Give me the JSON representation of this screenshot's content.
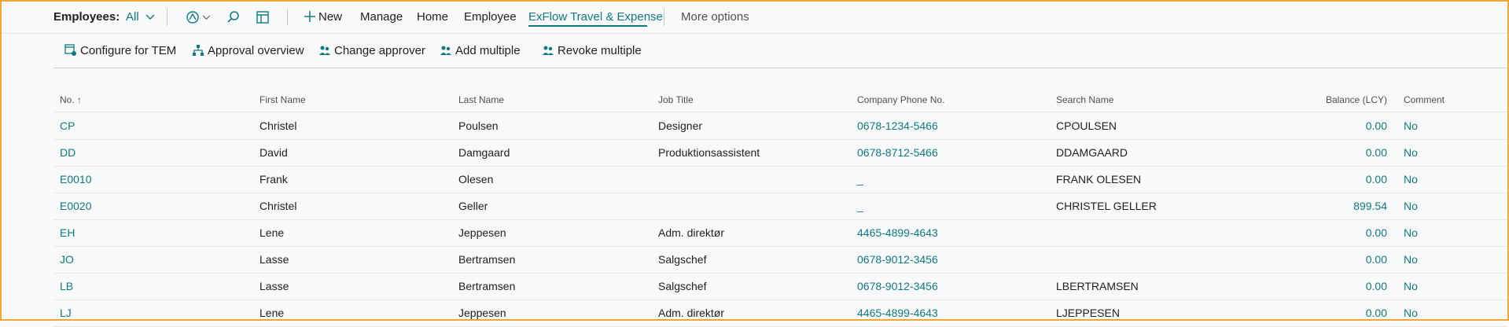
{
  "topbar": {
    "title": "Employees:",
    "filter": "All",
    "new_label": "New",
    "menus": [
      "Manage",
      "Home",
      "Employee",
      "ExFlow Travel & Expense"
    ],
    "more_options": "More options"
  },
  "subbar": {
    "buttons": [
      "Configure for TEM",
      "Approval overview",
      "Change approver",
      "Add multiple",
      "Revoke multiple"
    ]
  },
  "table": {
    "columns": [
      "No. ↑",
      "First Name",
      "Last Name",
      "Job Title",
      "Company Phone No.",
      "Search Name",
      "Balance (LCY)",
      "Comment"
    ],
    "rows": [
      {
        "no": "CP",
        "first": "Christel",
        "last": "Poulsen",
        "job": "Designer",
        "phone": "0678-1234-5466",
        "search": "CPOULSEN",
        "balance": "0.00",
        "comment": "No"
      },
      {
        "no": "DD",
        "first": "David",
        "last": "Damgaard",
        "job": "Produktionsassistent",
        "phone": "0678-8712-5466",
        "search": "DDAMGAARD",
        "balance": "0.00",
        "comment": "No"
      },
      {
        "no": "E0010",
        "first": "Frank",
        "last": "Olesen",
        "job": "",
        "phone": "_",
        "search": "FRANK OLESEN",
        "balance": "0.00",
        "comment": "No"
      },
      {
        "no": "E0020",
        "first": "Christel",
        "last": "Geller",
        "job": "",
        "phone": "_",
        "search": "CHRISTEL GELLER",
        "balance": "899.54",
        "comment": "No"
      },
      {
        "no": "EH",
        "first": "Lene",
        "last": "Jeppesen",
        "job": "Adm. direktør",
        "phone": "4465-4899-4643",
        "search": "",
        "balance": "0.00",
        "comment": "No"
      },
      {
        "no": "JO",
        "first": "Lasse",
        "last": "Bertramsen",
        "job": "Salgschef",
        "phone": "0678-9012-3456",
        "search": "",
        "balance": "0.00",
        "comment": "No"
      },
      {
        "no": "LB",
        "first": "Lasse",
        "last": "Bertramsen",
        "job": "Salgschef",
        "phone": "0678-9012-3456",
        "search": "LBERTRAMSEN",
        "balance": "0.00",
        "comment": "No"
      },
      {
        "no": "LJ",
        "first": "Lene",
        "last": "Jeppesen",
        "job": "Adm. direktør",
        "phone": "4465-4899-4643",
        "search": "LJEPPESEN",
        "balance": "0.00",
        "comment": "No"
      }
    ]
  },
  "colors": {
    "accent": "#0f7a80",
    "frame": "#f0a830",
    "background": "#f8f9fa"
  },
  "icons": [
    "analyze-icon",
    "chevron-down-icon",
    "search-icon",
    "layout-icon",
    "plus-icon",
    "configure-icon",
    "hierarchy-icon",
    "people-icon"
  ]
}
